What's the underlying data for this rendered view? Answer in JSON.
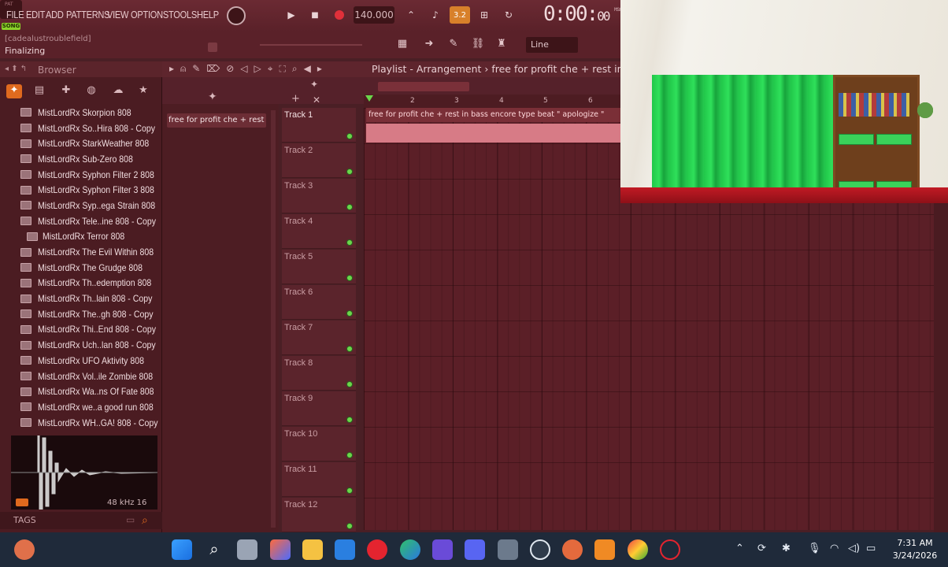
{
  "menu": [
    "FILE",
    "EDIT",
    "ADD",
    "PATTERNS",
    "VIEW",
    "OPTIONS",
    "TOOLS",
    "HELP"
  ],
  "transport": {
    "pat_label": "PAT",
    "song_label": "SONG",
    "tempo": "140.000",
    "time_main": "0:00:",
    "time_small": "00",
    "time_units": "M:S:CS"
  },
  "hint": {
    "user": "[cadealustroublefield]",
    "status": "Finalizing"
  },
  "snap": {
    "value": "Line"
  },
  "browser": {
    "title": "Browser",
    "files": [
      "MistLordRx Skorpion 808",
      "MistLordRx So..Hira 808 - Copy",
      "MistLordRx StarkWeather 808",
      "MistLordRx Sub-Zero 808",
      "MistLordRx Syphon Filter 2 808",
      "MistLordRx Syphon Filter 3 808",
      "MistLordRx Syp..ega Strain 808",
      "MistLordRx Tele..ine 808 - Copy",
      "MistLordRx Terror 808",
      "MistLordRx The Evil Within 808",
      "MistLordRx The Grudge 808",
      "MistLordRx Th..edemption 808",
      "MistLordRx Th..lain 808 - Copy",
      "MistLordRx The..gh 808 - Copy",
      "MistLordRx Thi..End 808 - Copy",
      "MistLordRx Uch..lan 808 - Copy",
      "MistLordRx UFO Aktivity 808",
      "MistLordRx Vol..ile Zombie 808",
      "MistLordRx Wa..ns Of Fate 808",
      "MistLordRx we..a good run 808",
      "MistLordRx WH..GA! 808 - Copy"
    ],
    "selected_index": 8,
    "sample_info": "48 kHz 16",
    "tags_label": "TAGS"
  },
  "pattern": {
    "label": "free for profit che + rest i..."
  },
  "playlist": {
    "title": "Playlist - Arrangement › free for profit che + rest in bass encore type beat  \" apologize \"",
    "bars": [
      "2",
      "3",
      "4",
      "5",
      "6"
    ],
    "clip_name": "free for profit che + rest in bass encore type beat  \" apologize \"",
    "tracks": [
      "Track 1",
      "Track 2",
      "Track 3",
      "Track 4",
      "Track 5",
      "Track 6",
      "Track 7",
      "Track 8",
      "Track 9",
      "Track 10",
      "Track 11",
      "Track 12"
    ]
  },
  "clock": {
    "time": "7:31 AM",
    "date": "3/24/2026"
  },
  "colors": {
    "accent": "#e06a1e",
    "clip": "#d77b86",
    "led": "#6bd64b",
    "song": "#8bd12a"
  }
}
